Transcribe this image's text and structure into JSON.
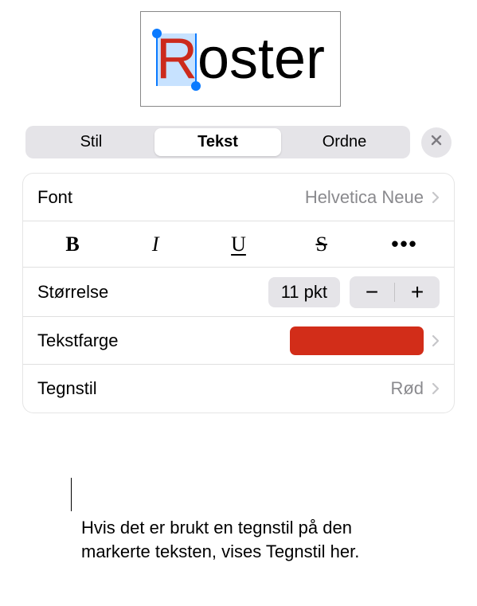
{
  "preview": {
    "word_first": "R",
    "word_rest": "oster"
  },
  "tabs": {
    "style": "Stil",
    "text": "Tekst",
    "arrange": "Ordne"
  },
  "font_row": {
    "label": "Font",
    "value": "Helvetica Neue"
  },
  "style_buttons": {
    "bold": "B",
    "italic": "I",
    "underline": "U",
    "strike": "S",
    "more": "•••"
  },
  "size_row": {
    "label": "Størrelse",
    "value": "11 pkt",
    "minus": "−",
    "plus": "+"
  },
  "color_row": {
    "label": "Tekstfarge",
    "swatch_hex": "#d22d19"
  },
  "charstyle_row": {
    "label": "Tegnstil",
    "value": "Rød"
  },
  "callout": "Hvis det er brukt en tegnstil på den markerte teksten, vises Tegnstil her."
}
